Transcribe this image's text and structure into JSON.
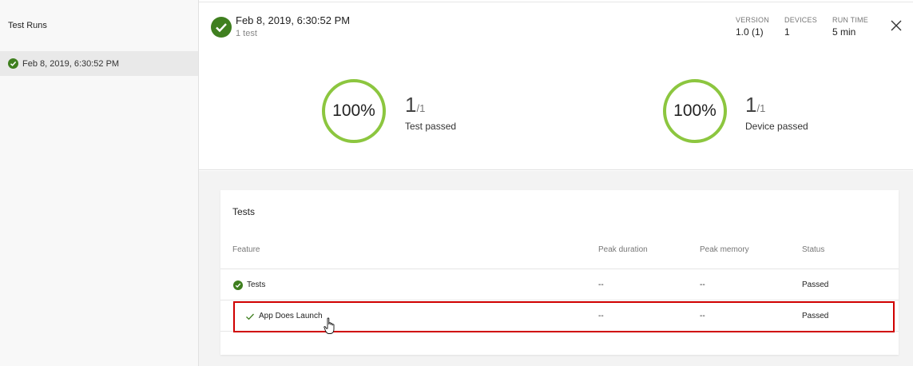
{
  "sidebar": {
    "title": "Test Runs",
    "items": [
      {
        "label": "Feb 8, 2019, 6:30:52 PM",
        "icon": "check-circle-icon"
      }
    ]
  },
  "header": {
    "title": "Feb 8, 2019, 6:30:52 PM",
    "subtitle": "1 test",
    "meta": [
      {
        "label": "VERSION",
        "value": "1.0 (1)"
      },
      {
        "label": "DEVICES",
        "value": "1"
      },
      {
        "label": "RUN TIME",
        "value": "5 min"
      }
    ],
    "close_icon": "close-icon"
  },
  "summary": {
    "tests": {
      "percent": "100%",
      "passed": "1",
      "total": "/1",
      "label": "Test passed"
    },
    "devices": {
      "percent": "100%",
      "passed": "1",
      "total": "/1",
      "label": "Device passed"
    }
  },
  "table": {
    "title": "Tests",
    "columns": [
      "Feature",
      "Peak duration",
      "Peak memory",
      "Status"
    ],
    "rows": [
      {
        "feature": "Tests",
        "duration": "--",
        "memory": "--",
        "status": "Passed",
        "icon": "check-circle-icon"
      },
      {
        "feature": "App Does Launch",
        "duration": "--",
        "memory": "--",
        "status": "Passed",
        "icon": "check-icon"
      }
    ]
  },
  "colors": {
    "success_dark": "#3f7f1f",
    "ring_green": "#8cc63f",
    "highlight_red": "#d00000"
  }
}
